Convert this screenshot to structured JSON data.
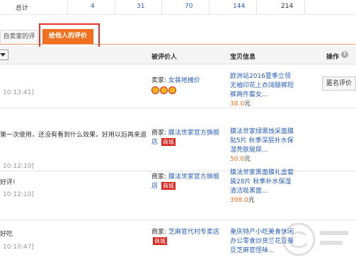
{
  "totals": {
    "label": "总计",
    "values": [
      "4",
      "31",
      "70",
      "144",
      "214"
    ]
  },
  "tabs": {
    "received_tab": "自卖家的评价",
    "given_tab": "给他人的评价"
  },
  "header": {
    "evaluatee": "被评价人",
    "item_info": "宝贝信息",
    "action": "操作",
    "help_symbol": "?"
  },
  "rows": [
    {
      "comment": "",
      "time": "10:13:41]",
      "role": "卖家:",
      "name": "女装地摊价",
      "mall_badge": "",
      "item_title": "欧洲站2016夏季立领无袖印花上衣阔腿裤短裤两件套女...",
      "price": "38.0",
      "unit": "元",
      "action": "匿名评价"
    },
    {
      "comment": "第一次使用，还没有看到什么效果，好用以后再来追",
      "time": "10:12:10]",
      "role": "商家:",
      "name": "膜法世家官方旗舰店",
      "mall_badge": "商城",
      "item_title": "膜法世家绿黑烛采面膜贴5片 秋季深层补水保湿亮肤玻尿...",
      "price": "50.0",
      "unit": "元",
      "action": ""
    },
    {
      "comment": "好评!",
      "time": "10:12:10]",
      "role": "商家:",
      "name": "膜法世家官方旗舰店",
      "mall_badge": "商城",
      "item_title": "膜法世家黑面膜礼盒套装28片 秋季补水保湿清洁吸黑面...",
      "price": "398.0",
      "unit": "元",
      "action": ""
    },
    {
      "comment": "好吃",
      "time": "10:10:47]",
      "role": "商家:",
      "name": "芝麻官代村专卖店",
      "mall_badge": "商城",
      "item_title": "重庆特产小吃美食休闲办公零食炒货兰花豆蚕豆芝麻官怪味...",
      "price": "",
      "unit": "",
      "action": ""
    }
  ],
  "colors": {
    "accent": "#f07020",
    "link": "#2b5fb4",
    "highlight_box": "#e8332a",
    "mall": "#d9251d"
  }
}
